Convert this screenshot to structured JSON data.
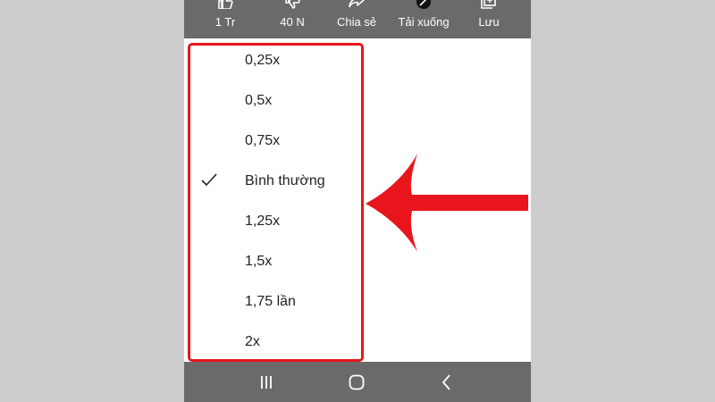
{
  "actions": [
    {
      "label": "1 Tr",
      "icon": "thumbs-up-icon"
    },
    {
      "label": "40 N",
      "icon": "thumbs-down-icon"
    },
    {
      "label": "Chia sẻ",
      "icon": "share-icon"
    },
    {
      "label": "Tải xuống",
      "icon": "download-icon"
    },
    {
      "label": "Lưu",
      "icon": "save-to-playlist-icon"
    }
  ],
  "speed_options": [
    {
      "label": "0,25x",
      "selected": false
    },
    {
      "label": "0,5x",
      "selected": false
    },
    {
      "label": "0,75x",
      "selected": false
    },
    {
      "label": "Bình thường",
      "selected": true
    },
    {
      "label": "1,25x",
      "selected": false
    },
    {
      "label": "1,5x",
      "selected": false
    },
    {
      "label": "1,75 lần",
      "selected": false
    },
    {
      "label": "2x",
      "selected": false
    }
  ],
  "nav": [
    {
      "icon": "recent-apps-icon"
    },
    {
      "icon": "home-icon"
    },
    {
      "icon": "back-icon"
    }
  ],
  "colors": {
    "annotation": "#e8161c",
    "bars": "#6a6a6a",
    "outer_background": "#cdcdcd"
  }
}
